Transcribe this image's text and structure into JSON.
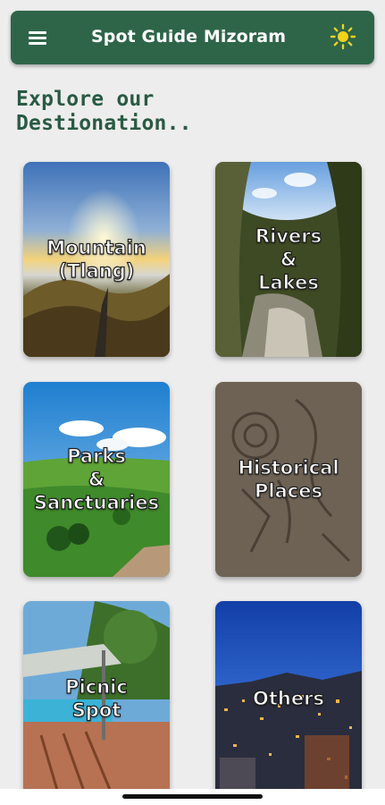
{
  "appbar": {
    "title": "Spot Guide Mizoram",
    "menu_icon": "hamburger-menu-icon",
    "theme_icon": "sun-icon"
  },
  "colors": {
    "appbar_bg": "#2e6549",
    "heading": "#2a5a43",
    "page_bg": "#ededed",
    "sun": "#f2d21b"
  },
  "main": {
    "heading": "Explore our\nDestionation..",
    "categories": [
      {
        "label": "Mountain\n(Tlang)"
      },
      {
        "label": "Rivers\n&\nLakes"
      },
      {
        "label": "Parks\n&\nSanctuaries"
      },
      {
        "label": "Historical\nPlaces"
      },
      {
        "label": "Picnic\nSpot"
      },
      {
        "label": "Others"
      }
    ]
  }
}
